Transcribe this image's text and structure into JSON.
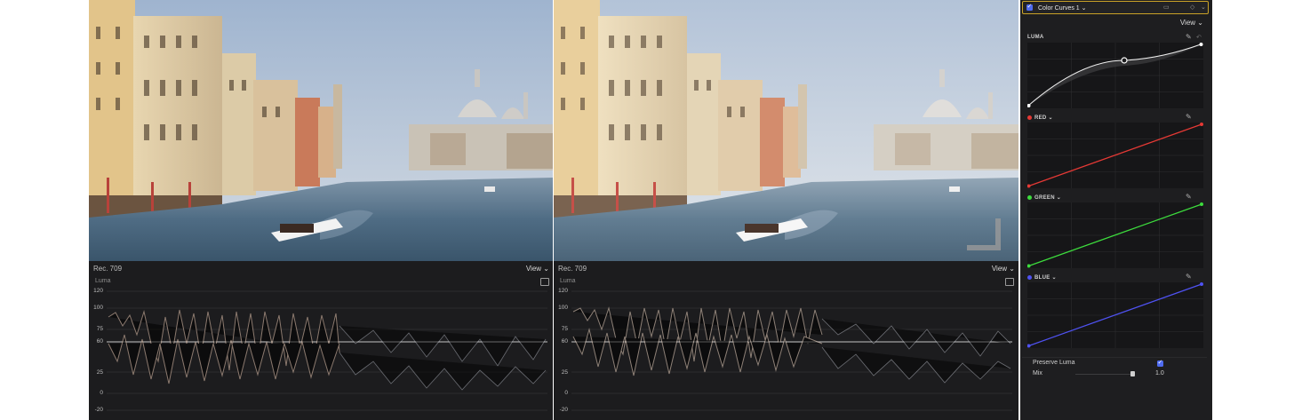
{
  "left_viewer": {
    "scope": {
      "colorspace": "Rec. 709",
      "view_label": "View",
      "type_label": "Luma",
      "ticks": [
        "120",
        "100",
        "75",
        "60",
        "25",
        "0",
        "-20"
      ]
    }
  },
  "right_viewer": {
    "scope": {
      "colorspace": "Rec. 709",
      "view_label": "View",
      "type_label": "Luma",
      "ticks": [
        "120",
        "100",
        "75",
        "60",
        "25",
        "0",
        "-20"
      ]
    }
  },
  "inspector": {
    "effect_name": "Color Curves 1",
    "effect_enabled": true,
    "view_label": "View",
    "curves": {
      "luma": {
        "label": "LUMA",
        "color": "#ffffff"
      },
      "red": {
        "label": "RED",
        "color": "#e53935"
      },
      "green": {
        "label": "GREEN",
        "color": "#3ddc3d"
      },
      "blue": {
        "label": "BLUE",
        "color": "#4f52f2"
      }
    },
    "preserve_luma": {
      "label": "Preserve Luma",
      "checked": true
    },
    "mix": {
      "label": "Mix",
      "value": "1.0",
      "level": 1.0
    }
  }
}
